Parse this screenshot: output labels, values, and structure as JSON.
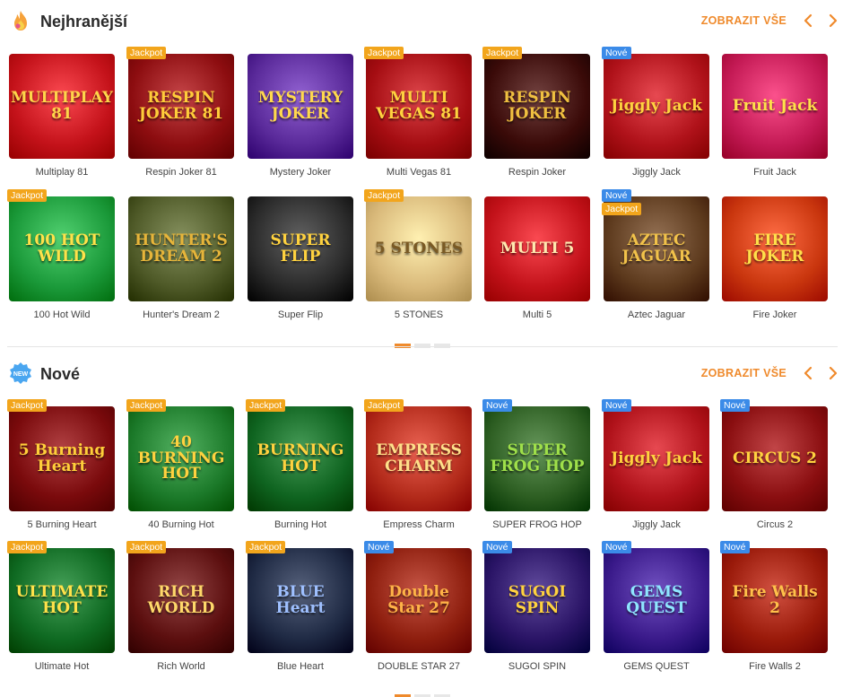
{
  "sections": [
    {
      "title": "Nejhranější",
      "icon": "fire-icon",
      "show_all": "ZOBRAZIT VŠE",
      "games": [
        {
          "name": "Multiplay 81",
          "art": "MULTIPLAY 81",
          "badges": [],
          "bg": "#c4121a",
          "fg": "#ffd54a"
        },
        {
          "name": "Respin Joker 81",
          "art": "RESPIN JOKER 81",
          "badges": [
            "Jackpot"
          ],
          "bg": "#8d0d10",
          "fg": "#ffcc3a"
        },
        {
          "name": "Mystery Joker",
          "art": "MYSTERY JOKER",
          "badges": [],
          "bg": "#5a2a9a",
          "fg": "#ffd84d"
        },
        {
          "name": "Multi Vegas 81",
          "art": "MULTI VEGAS 81",
          "badges": [
            "Jackpot"
          ],
          "bg": "#a50d12",
          "fg": "#ffd23f"
        },
        {
          "name": "Respin Joker",
          "art": "RESPIN JOKER",
          "badges": [
            "Jackpot"
          ],
          "bg": "#3a0a08",
          "fg": "#f0c040"
        },
        {
          "name": "Jiggly Jack",
          "art": "Jiggly Jack",
          "badges": [
            "Nové"
          ],
          "bg": "#b0121a",
          "fg": "#ffd23f"
        },
        {
          "name": "Fruit Jack",
          "art": "Fruit Jack",
          "badges": [],
          "bg": "#c41a55",
          "fg": "#ffe04a"
        }
      ]
    },
    {
      "title": "",
      "games": [
        {
          "name": "100 Hot Wild",
          "art": "100 HOT WILD",
          "badges": [
            "Jackpot"
          ],
          "bg": "#1b9a3a",
          "fg": "#ffe24a"
        },
        {
          "name": "Hunter's Dream 2",
          "art": "HUNTER'S DREAM 2",
          "badges": [],
          "bg": "#4f5a28",
          "fg": "#e7b53a"
        },
        {
          "name": "Super Flip",
          "art": "SUPER FLIP",
          "badges": [],
          "bg": "#2a2a2a",
          "fg": "#ffd23f"
        },
        {
          "name": "5 STONES",
          "art": "5 STONES",
          "badges": [
            "Jackpot"
          ],
          "bg": "#d9b97a",
          "fg": "#7a5a24"
        },
        {
          "name": "Multi 5",
          "art": "MULTI 5",
          "badges": [],
          "bg": "#c3121a",
          "fg": "#ffe9b0"
        },
        {
          "name": "Aztec Jaguar",
          "art": "AZTEC JAGUAR",
          "badges": [
            "Nové",
            "Jackpot"
          ],
          "bg": "#5d3a1d",
          "fg": "#f2c24a"
        },
        {
          "name": "Fire Joker",
          "art": "FIRE JOKER",
          "badges": [],
          "bg": "#c9360e",
          "fg": "#ffe04a"
        }
      ]
    },
    {
      "title": "Nové",
      "icon": "new-icon",
      "show_all": "ZOBRAZIT VŠE",
      "games": [
        {
          "name": "5 Burning Heart",
          "art": "5 Burning Heart",
          "badges": [
            "Jackpot"
          ],
          "bg": "#7a0a0c",
          "fg": "#ffcf3a"
        },
        {
          "name": "40 Burning Hot",
          "art": "40 BURNING HOT",
          "badges": [
            "Jackpot"
          ],
          "bg": "#1c7a2a",
          "fg": "#ffd23f"
        },
        {
          "name": "Burning Hot",
          "art": "BURNING HOT",
          "badges": [
            "Jackpot"
          ],
          "bg": "#0f6420",
          "fg": "#ffd23f"
        },
        {
          "name": "Empress Charm",
          "art": "EMPRESS CHARM",
          "badges": [
            "Jackpot"
          ],
          "bg": "#b22a1a",
          "fg": "#ffe08a"
        },
        {
          "name": "SUPER FROG HOP",
          "art": "SUPER FROG HOP",
          "badges": [
            "Nové"
          ],
          "bg": "#2d5e22",
          "fg": "#9fe04a"
        },
        {
          "name": "Jiggly Jack",
          "art": "Jiggly Jack",
          "badges": [
            "Nové"
          ],
          "bg": "#b0121a",
          "fg": "#ffd23f"
        },
        {
          "name": "Circus 2",
          "art": "CIRCUS 2",
          "badges": [
            "Nové"
          ],
          "bg": "#8a0e10",
          "fg": "#ffd23f"
        }
      ]
    },
    {
      "title": "",
      "games": [
        {
          "name": "Ultimate Hot",
          "art": "ULTIMATE HOT",
          "badges": [
            "Jackpot"
          ],
          "bg": "#0f6a22",
          "fg": "#ffe24a"
        },
        {
          "name": "Rich World",
          "art": "RICH WORLD",
          "badges": [
            "Jackpot"
          ],
          "bg": "#5c0f0f",
          "fg": "#ffd86a"
        },
        {
          "name": "Blue Heart",
          "art": "BLUE Heart",
          "badges": [
            "Jackpot"
          ],
          "bg": "#1f2a44",
          "fg": "#9fc0ff"
        },
        {
          "name": "DOUBLE STAR 27",
          "art": "Double Star 27",
          "badges": [
            "Nové"
          ],
          "bg": "#8e1e0e",
          "fg": "#ffb347"
        },
        {
          "name": "SUGOI SPIN",
          "art": "SUGOI SPIN",
          "badges": [
            "Nové"
          ],
          "bg": "#2a1466",
          "fg": "#ffd23f"
        },
        {
          "name": "GEMS QUEST",
          "art": "GEMS QUEST",
          "badges": [
            "Nové"
          ],
          "bg": "#3a1a8a",
          "fg": "#8fe6ff"
        },
        {
          "name": "Fire Walls 2",
          "art": "Fire Walls 2",
          "badges": [
            "Nové"
          ],
          "bg": "#9a1a0a",
          "fg": "#ffc04a"
        }
      ]
    }
  ],
  "colors": {
    "accent": "#ef8a2c",
    "jackpot_badge": "#f2a51c",
    "new_badge": "#3b8be8"
  }
}
